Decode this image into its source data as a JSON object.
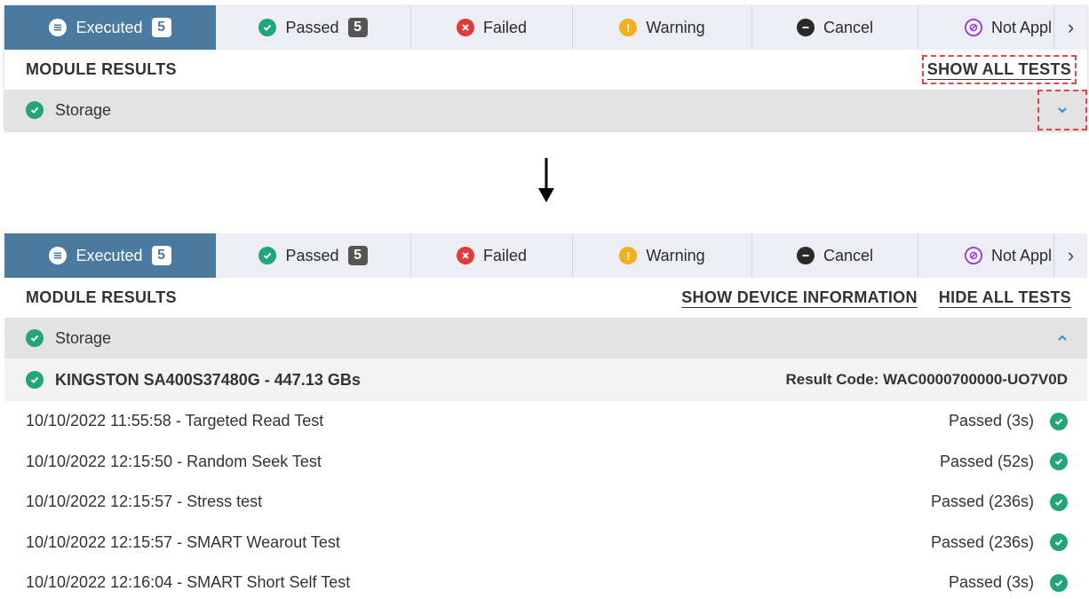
{
  "tabs": [
    {
      "label": "Executed",
      "count": "5",
      "icon": "list-circle-icon"
    },
    {
      "label": "Passed",
      "count": "5",
      "icon": "check-circle-icon"
    },
    {
      "label": "Failed",
      "icon": "x-circle-icon"
    },
    {
      "label": "Warning",
      "icon": "exclamation-circle-icon"
    },
    {
      "label": "Cancel",
      "icon": "minus-circle-icon"
    },
    {
      "label": "Not Appl",
      "icon": "slash-circle-icon"
    }
  ],
  "tab_next_glyph": "›",
  "module_results_label": "MODULE RESULTS",
  "before": {
    "show_all_tests": "SHOW ALL TESTS",
    "module": {
      "name": "Storage",
      "chevron": "⌄"
    }
  },
  "after": {
    "show_device_info": "SHOW DEVICE INFORMATION",
    "hide_all_tests": "HIDE ALL TESTS",
    "module": {
      "name": "Storage",
      "chevron": "⌃"
    },
    "device": {
      "name": "KINGSTON SA400S37480G - 447.13 GBs",
      "result_code": "Result Code: WAC0000700000-UO7V0D"
    },
    "tests": [
      {
        "name": "10/10/2022 11:55:58 - Targeted Read Test",
        "status": "Passed (3s)"
      },
      {
        "name": "10/10/2022 12:15:50 - Random Seek Test",
        "status": "Passed (52s)"
      },
      {
        "name": "10/10/2022 12:15:57 - Stress test",
        "status": "Passed (236s)"
      },
      {
        "name": "10/10/2022 12:15:57 - SMART Wearout Test",
        "status": "Passed (236s)"
      },
      {
        "name": "10/10/2022 12:16:04 - SMART Short Self Test",
        "status": "Passed (3s)"
      }
    ]
  },
  "colors": {
    "active_tab": "#4a7aa0",
    "passed": "#22a57a",
    "failed": "#e03a3a",
    "warning": "#f2b01e",
    "not_applicable": "#9b3ee8",
    "highlight_dash": "#e04848"
  }
}
